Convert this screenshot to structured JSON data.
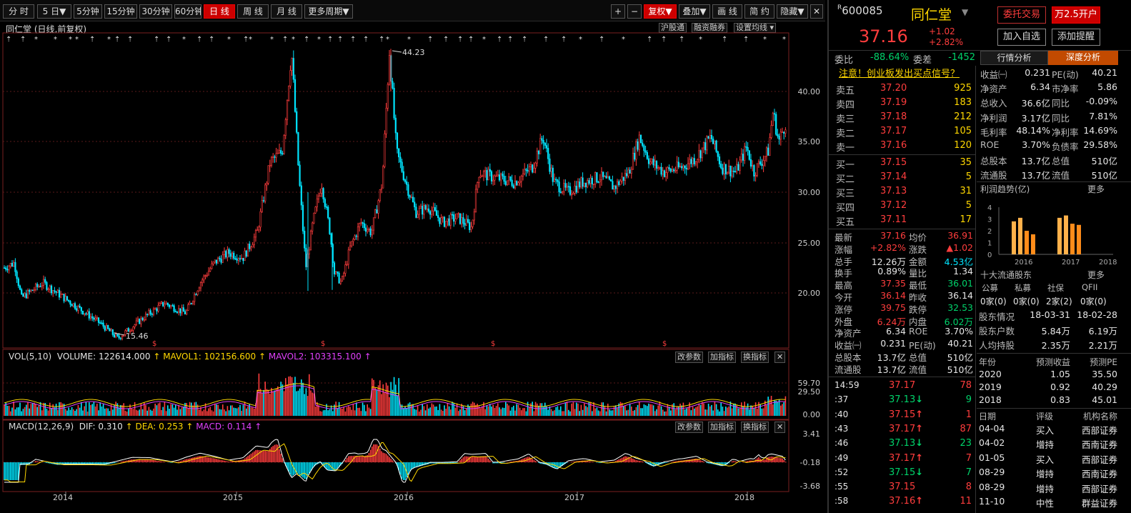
{
  "toolbar": {
    "periods": [
      "分 时",
      "5 日▼",
      "5分钟",
      "15分钟",
      "30分钟",
      "60分钟",
      "日 线",
      "周 线",
      "月 线",
      "更多周期▼"
    ],
    "right": [
      "+",
      "−",
      "复权▼",
      "叠加▼",
      "画 线",
      "简 约",
      "隐藏▼",
      "✕"
    ]
  },
  "chart_header": {
    "code": "同仁堂",
    "sub": "(日线,前复权)",
    "buttons": [
      "沪股通",
      "融资融券",
      "设置均线 ▾"
    ]
  },
  "price_axis": [
    "40.00",
    "35.00",
    "30.00",
    "25.00",
    "20.00"
  ],
  "price_notes": {
    "high": "44.23",
    "low": "15.46"
  },
  "vol_panel": {
    "title": "VOL(5,10)",
    "volume": "VOLUME: 122614.000",
    "mavol1": "MAVOL1: 102156.600",
    "mavol2": "MAVOL2: 103315.100",
    "axis": [
      "59.70",
      "29.50",
      "0.00"
    ],
    "buttons": [
      "改参数",
      "加指标",
      "换指标",
      "✕"
    ]
  },
  "macd_panel": {
    "title": "MACD(12,26,9)",
    "dif": "DIF: 0.310",
    "dea": "DEA: 0.253",
    "macd": "MACD: 0.114",
    "axis": [
      "3.41",
      "-0.18",
      "-3.68"
    ],
    "buttons": [
      "改参数",
      "加指标",
      "换指标",
      "✕"
    ]
  },
  "x_years": [
    "2014",
    "2015",
    "2016",
    "2017",
    "2018"
  ],
  "stock": {
    "code": "600085",
    "name": "同仁堂",
    "price": "37.16",
    "change": "+1.02",
    "pct": "+2.82%",
    "btn_trade": "委托交易",
    "btn_open": "万2.5开户",
    "btn_watch": "加入自选",
    "btn_alert": "添加提醒"
  },
  "ratio": {
    "wb_label": "委比",
    "wb": "-88.64%",
    "wc_label": "委差",
    "wc": "-1452"
  },
  "tabs": [
    "行情分析",
    "深度分析"
  ],
  "notice": "注意！创业板发出买点信号？",
  "sells": [
    [
      "卖五",
      "37.20",
      "925"
    ],
    [
      "卖四",
      "37.19",
      "183"
    ],
    [
      "卖三",
      "37.18",
      "212"
    ],
    [
      "卖二",
      "37.17",
      "105"
    ],
    [
      "卖一",
      "37.16",
      "120"
    ]
  ],
  "buys": [
    [
      "买一",
      "37.15",
      "35"
    ],
    [
      "买二",
      "37.14",
      "5"
    ],
    [
      "买三",
      "37.13",
      "31"
    ],
    [
      "买四",
      "37.12",
      "5"
    ],
    [
      "买五",
      "37.11",
      "17"
    ]
  ],
  "stats": [
    [
      "最新",
      "37.16",
      "均价",
      "36.91"
    ],
    [
      "涨幅",
      "+2.82%",
      "涨跌",
      "▲1.02"
    ],
    [
      "总手",
      "12.26万",
      "金额",
      "4.53亿"
    ],
    [
      "换手",
      "0.89%",
      "量比",
      "1.34"
    ],
    [
      "最高",
      "37.35",
      "最低",
      "36.01"
    ],
    [
      "今开",
      "36.14",
      "昨收",
      "36.14"
    ],
    [
      "涨停",
      "39.75",
      "跌停",
      "32.53"
    ],
    [
      "外盘",
      "6.24万",
      "内盘",
      "6.02万"
    ],
    [
      "净资产",
      "6.34",
      "ROE",
      "3.70%"
    ],
    [
      "收益㈠",
      "0.231",
      "PE(动)",
      "40.21"
    ],
    [
      "总股本",
      "13.7亿",
      "总值",
      "510亿"
    ],
    [
      "流通股",
      "13.7亿",
      "流值",
      "510亿"
    ]
  ],
  "ticks": [
    [
      "14:59",
      "37.17",
      "",
      "78"
    ],
    [
      ":37",
      "37.13",
      "↓",
      "9"
    ],
    [
      ":40",
      "37.15",
      "↑",
      "1"
    ],
    [
      ":43",
      "37.17",
      "↑",
      "87"
    ],
    [
      ":46",
      "37.13",
      "↓",
      "23"
    ],
    [
      ":49",
      "37.17",
      "↑",
      "7"
    ],
    [
      ":52",
      "37.15",
      "↓",
      "7"
    ],
    [
      ":55",
      "37.15",
      "",
      "8"
    ],
    [
      ":58",
      "37.16",
      "↑",
      "11"
    ]
  ],
  "deep": [
    [
      "收益㈠",
      "0.231",
      "PE(动)",
      "40.21"
    ],
    [
      "净资产",
      "6.34",
      "市净率",
      "5.86"
    ],
    [
      "总收入",
      "36.6亿",
      "同比",
      "-0.09%"
    ],
    [
      "净利润",
      "3.17亿",
      "同比",
      "7.81%"
    ],
    [
      "毛利率",
      "48.14%",
      "净利率",
      "14.69%"
    ],
    [
      "ROE",
      "3.70%",
      "负债率",
      "29.58%"
    ],
    [
      "总股本",
      "13.7亿",
      "总值",
      "510亿"
    ],
    [
      "流通股",
      "13.7亿",
      "流值",
      "510亿"
    ]
  ],
  "profit": {
    "title": "利润趋势(亿)",
    "more": "更多",
    "yaxis": [
      "4",
      "3",
      "2",
      "1",
      "0"
    ],
    "years": [
      "2016",
      "2017",
      "2018"
    ],
    "bars": [
      2.8,
      3.1,
      2.0,
      1.7,
      3.1,
      3.3,
      2.6,
      2.5
    ]
  },
  "holders": {
    "title": "十大流通股东",
    "more": "更多",
    "heads": [
      "公募",
      "私募",
      "社保",
      "QFII"
    ],
    "vals": [
      "0家(0)",
      "0家(0)",
      "2家(2)",
      "0家(0)"
    ],
    "rows": [
      [
        "股东情况",
        "18-03-31",
        "18-02-28"
      ],
      [
        "股东户数",
        "5.84万",
        "6.19万"
      ],
      [
        "人均持股",
        "2.35万",
        "2.21万"
      ]
    ]
  },
  "forecast": {
    "heads": [
      "年份",
      "预测收益",
      "预测PE"
    ],
    "rows": [
      [
        "2020",
        "1.05",
        "35.50"
      ],
      [
        "2019",
        "0.92",
        "40.29"
      ],
      [
        "2018",
        "0.83",
        "45.01"
      ]
    ]
  },
  "ratings": {
    "heads": [
      "日期",
      "评级",
      "机构名称"
    ],
    "rows": [
      [
        "04-04",
        "买入",
        "西部证券"
      ],
      [
        "04-02",
        "增持",
        "西南证券"
      ],
      [
        "01-05",
        "买入",
        "西部证券"
      ],
      [
        "08-29",
        "增持",
        "西南证券"
      ],
      [
        "08-29",
        "增持",
        "西部证券"
      ],
      [
        "11-10",
        "中性",
        "群益证券"
      ]
    ]
  }
}
